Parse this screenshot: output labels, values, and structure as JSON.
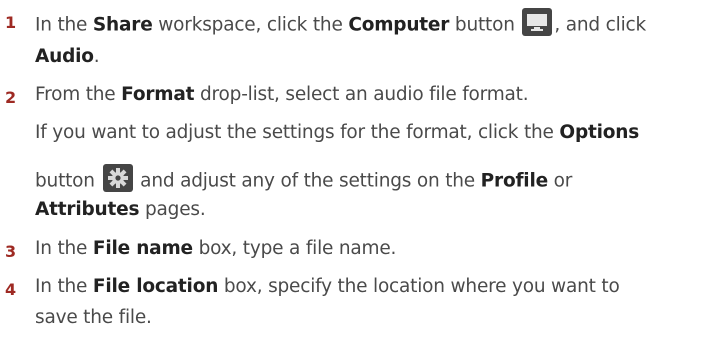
{
  "steps": [
    {
      "number": "1",
      "lines": [
        [
          "In the ",
          "Share",
          " workspace, click the ",
          "Computer",
          " button ",
          "",
          ", and click"
        ],
        [
          "Audio",
          "."
        ]
      ]
    },
    {
      "number": "2",
      "lines": [
        [
          "From the ",
          "Format",
          " drop-list, select an audio file format."
        ],
        [
          "If you want to adjust the settings for the format, click the ",
          "Options"
        ],
        [
          "button ",
          "",
          " and adjust any of the settings on the ",
          "Profile",
          " or"
        ],
        [
          "Attributes",
          " pages."
        ]
      ]
    },
    {
      "number": "3",
      "lines": [
        [
          "In the ",
          "File name",
          " box, type a file name."
        ]
      ]
    },
    {
      "number": "4",
      "lines": [
        [
          "In the ",
          "File location",
          " box, specify the location where you want to"
        ],
        [
          "save the file."
        ]
      ]
    }
  ],
  "icons": {
    "computer": "monitor-icon",
    "options": "gear-icon"
  }
}
